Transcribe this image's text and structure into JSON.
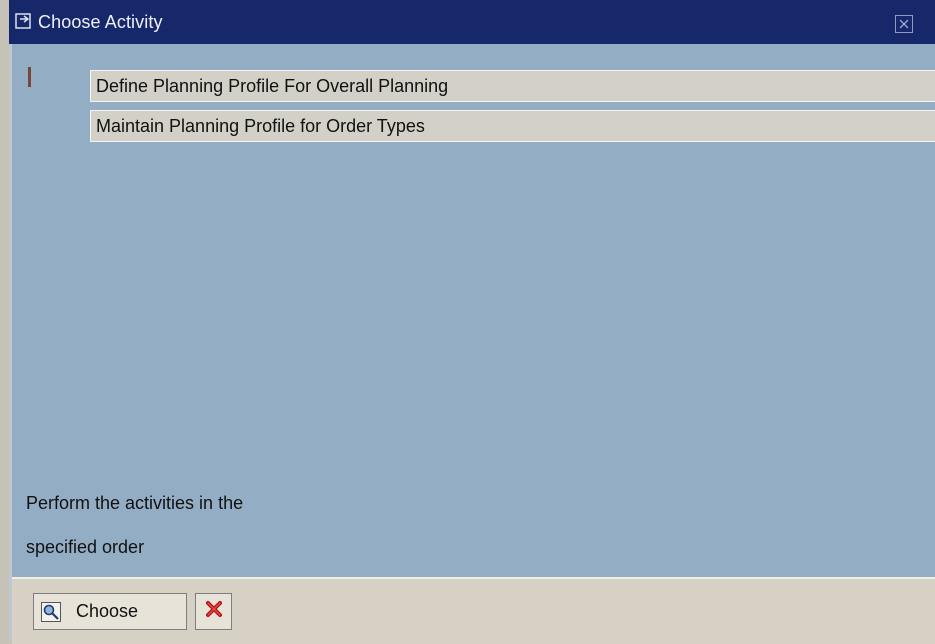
{
  "window": {
    "title": "Choose Activity",
    "title_icon": "dialog-icon",
    "close_icon": "close-icon"
  },
  "activities": [
    {
      "label": "Define Planning Profile For Overall Planning"
    },
    {
      "label": "Maintain Planning Profile for Order Types"
    }
  ],
  "hint": {
    "line1": "Perform the activities in the",
    "line2": "specified order"
  },
  "toolbar": {
    "choose_label": "Choose",
    "choose_icon": "magnifier-icon",
    "cancel_icon": "cancel-x-icon"
  }
}
